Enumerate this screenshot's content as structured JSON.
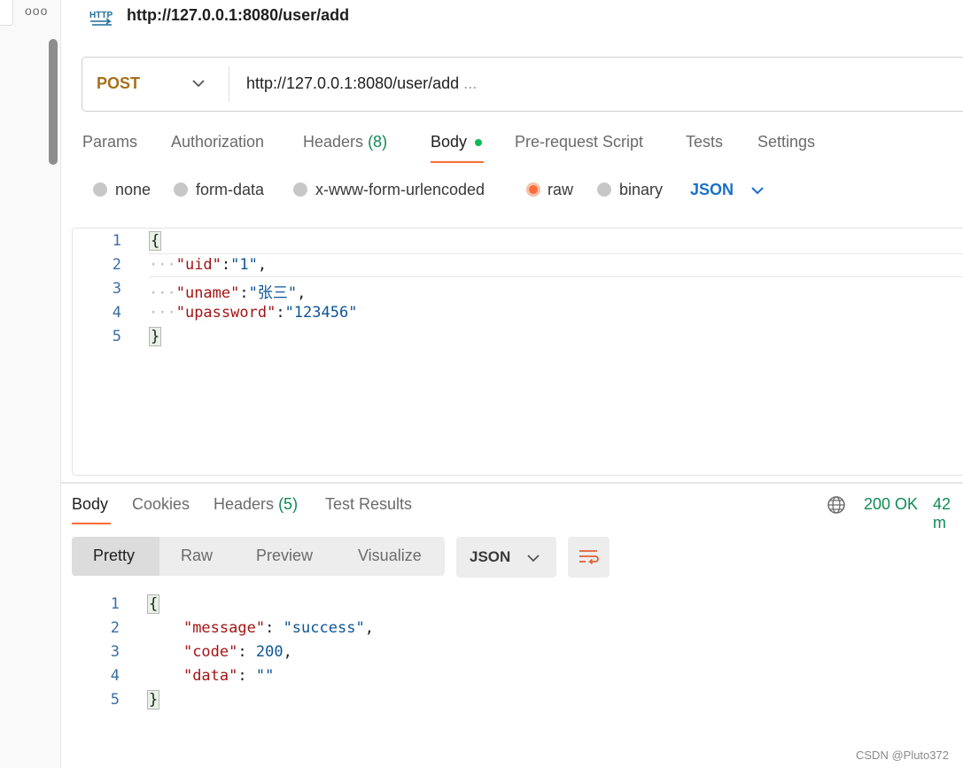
{
  "sidebar": {
    "more_label": "ooo"
  },
  "request": {
    "icon": "http-icon",
    "title": "http://127.0.0.1:8080/user/add",
    "method": "POST",
    "url": "http://127.0.0.1:8080/user/add",
    "url_ellipsis": "...",
    "tabs": [
      {
        "label": "Params"
      },
      {
        "label": "Authorization"
      },
      {
        "label": "Headers",
        "count": "(8)"
      },
      {
        "label": "Body",
        "active": true
      },
      {
        "label": "Pre-request Script"
      },
      {
        "label": "Tests"
      },
      {
        "label": "Settings"
      }
    ],
    "body_types": [
      "none",
      "form-data",
      "x-www-form-urlencoded",
      "raw",
      "binary"
    ],
    "selected_body_type": "raw",
    "format": "JSON",
    "body_lines": [
      {
        "n": "1",
        "text": "{"
      },
      {
        "n": "2",
        "key": "\"uid\"",
        "value": "\"1\"",
        "trail": ","
      },
      {
        "n": "3",
        "key": "\"uname\"",
        "value": "\"张三\"",
        "trail": ","
      },
      {
        "n": "4",
        "key": "\"upassword\"",
        "value": "\"123456\"",
        "trail": ""
      },
      {
        "n": "5",
        "text": "}"
      }
    ]
  },
  "response": {
    "tabs": [
      {
        "label": "Body",
        "active": true
      },
      {
        "label": "Cookies"
      },
      {
        "label": "Headers",
        "count": "(5)"
      },
      {
        "label": "Test Results"
      }
    ],
    "status": "200 OK",
    "time": "42 m",
    "views": [
      "Pretty",
      "Raw",
      "Preview",
      "Visualize"
    ],
    "active_view": "Pretty",
    "format": "JSON",
    "body_lines": [
      {
        "n": "1",
        "text": "{"
      },
      {
        "n": "2",
        "key": "\"message\"",
        "value": "\"success\"",
        "trail": ","
      },
      {
        "n": "3",
        "key": "\"code\"",
        "value": "200",
        "trail": ","
      },
      {
        "n": "4",
        "key": "\"data\"",
        "value": "\"\"",
        "trail": ""
      },
      {
        "n": "5",
        "text": "}"
      }
    ]
  },
  "watermark": "CSDN @Pluto372",
  "colors": {
    "accent": "#ff6c37",
    "method": "#a6701a",
    "success": "#0f8a55",
    "link": "#1a6fc9"
  }
}
